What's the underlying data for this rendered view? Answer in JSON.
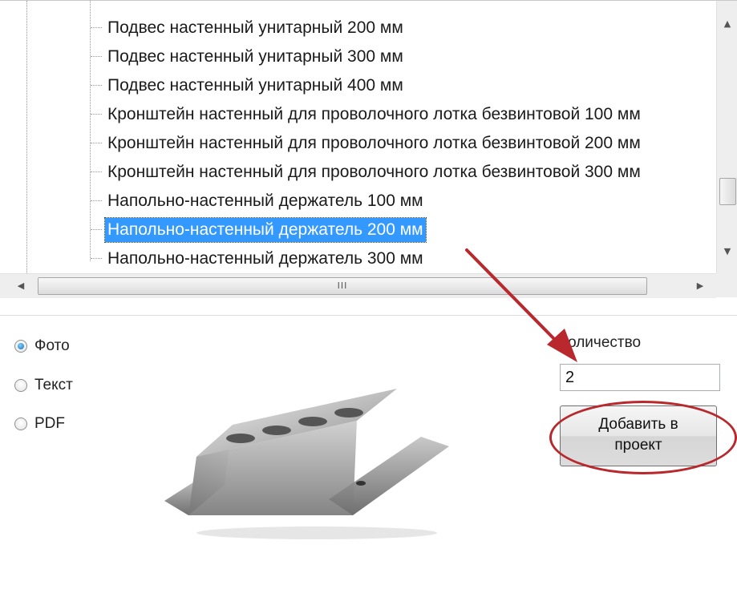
{
  "tree": {
    "items": [
      {
        "label": "Подвес настенный унитарный 200 мм",
        "selected": false
      },
      {
        "label": "Подвес настенный унитарный 300 мм",
        "selected": false
      },
      {
        "label": "Подвес настенный унитарный 400 мм",
        "selected": false
      },
      {
        "label": "Кронштейн настенный для проволочного лотка безвинтовой 100 мм",
        "selected": false
      },
      {
        "label": "Кронштейн настенный для проволочного лотка безвинтовой 200 мм",
        "selected": false
      },
      {
        "label": "Кронштейн настенный для проволочного лотка безвинтовой 300 мм",
        "selected": false
      },
      {
        "label": "Напольно-настенный держатель 100 мм",
        "selected": false
      },
      {
        "label": "Напольно-настенный держатель 200 мм",
        "selected": true
      },
      {
        "label": "Напольно-настенный держатель 300 мм",
        "selected": false
      }
    ],
    "selection_color": "#3399ff",
    "hscroll_grip": "III"
  },
  "view_options": [
    {
      "label": "Фото",
      "checked": true
    },
    {
      "label": "Текст",
      "checked": false
    },
    {
      "label": "PDF",
      "checked": false
    }
  ],
  "quantity": {
    "label": "Количество",
    "value": "2"
  },
  "add_button": {
    "label": "Добавить в\nпроект"
  },
  "annotation": {
    "color": "#b8282c",
    "arrow_icon": "red-arrow-icon",
    "highlight_icon": "red-ellipse-highlight"
  },
  "product_image": {
    "icon": "metal-floor-wall-holder-photo"
  }
}
